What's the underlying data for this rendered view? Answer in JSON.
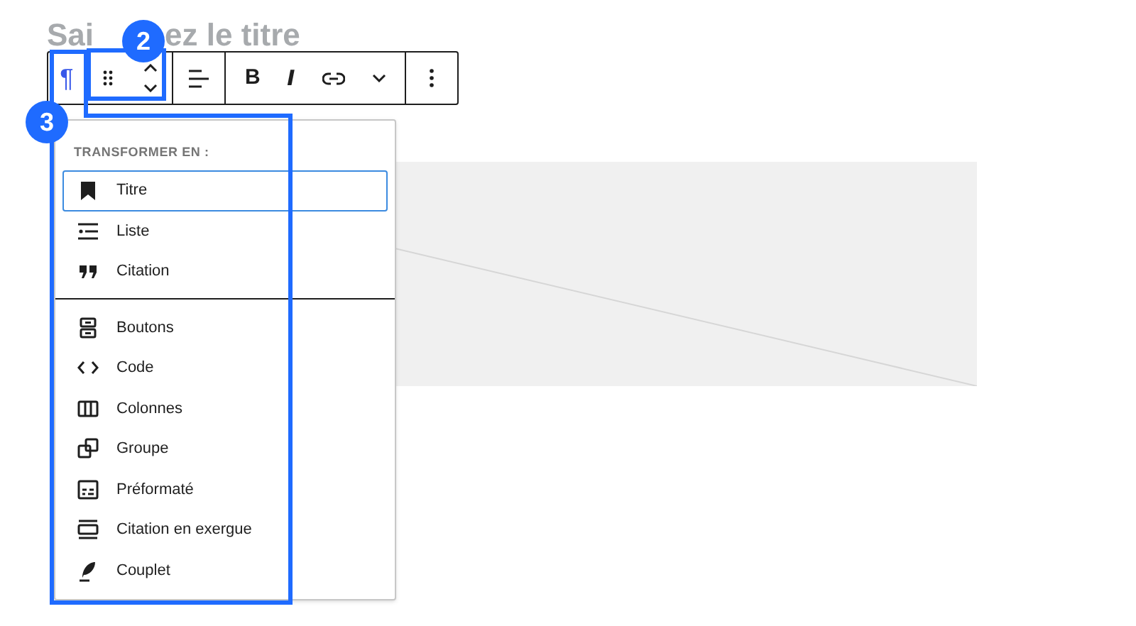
{
  "title_parts": [
    "Sai",
    "ez le titre"
  ],
  "toolbar": {
    "block_type": "¶",
    "bold": "B",
    "italic": "I"
  },
  "annotations": [
    {
      "number": "2"
    },
    {
      "number": "3"
    }
  ],
  "transform_menu": {
    "heading": "TRANSFORMER EN :",
    "groups": [
      [
        {
          "label": "Titre",
          "selected": true
        },
        {
          "label": "Liste",
          "selected": false
        },
        {
          "label": "Citation",
          "selected": false
        }
      ],
      [
        {
          "label": "Boutons",
          "selected": false
        },
        {
          "label": "Code",
          "selected": false
        },
        {
          "label": "Colonnes",
          "selected": false
        },
        {
          "label": "Groupe",
          "selected": false
        },
        {
          "label": "Préformaté",
          "selected": false
        },
        {
          "label": "Citation en exergue",
          "selected": false
        },
        {
          "label": "Couplet",
          "selected": false
        }
      ]
    ]
  }
}
